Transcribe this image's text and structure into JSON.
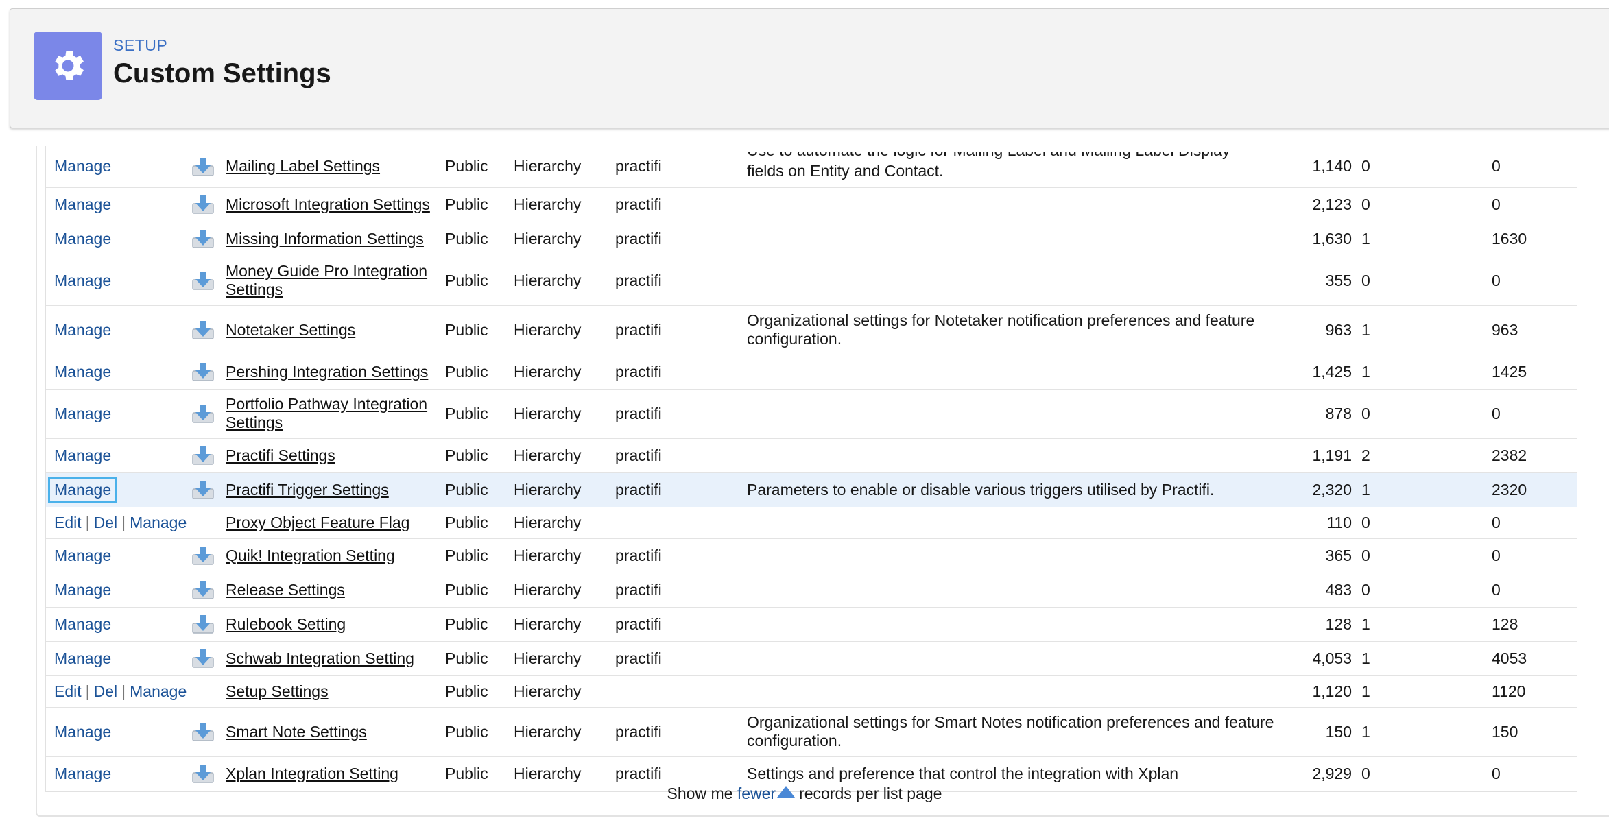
{
  "header": {
    "section": "SETUP",
    "title": "Custom Settings",
    "icon": "gear-icon",
    "icon_bg": "#7b87e8"
  },
  "rows": [
    {
      "actions": [
        "Manage"
      ],
      "packaged": true,
      "label": "Mailing Label Settings",
      "visibility": "Public",
      "type": "Hierarchy",
      "namespace": "practifi",
      "description": "fields on Entity and Contact.",
      "desc_cut": "Use to automate the logic for Mailing Label and Mailing Label Display",
      "size": "1,140",
      "records": "0",
      "total": "0"
    },
    {
      "actions": [
        "Manage"
      ],
      "packaged": true,
      "label": "Microsoft Integration Settings",
      "visibility": "Public",
      "type": "Hierarchy",
      "namespace": "practifi",
      "description": "",
      "size": "2,123",
      "records": "0",
      "total": "0"
    },
    {
      "actions": [
        "Manage"
      ],
      "packaged": true,
      "label": "Missing Information Settings",
      "visibility": "Public",
      "type": "Hierarchy",
      "namespace": "practifi",
      "description": "",
      "size": "1,630",
      "records": "1",
      "total": "1630"
    },
    {
      "actions": [
        "Manage"
      ],
      "packaged": true,
      "label": "Money Guide Pro Integration Settings",
      "visibility": "Public",
      "type": "Hierarchy",
      "namespace": "practifi",
      "description": "",
      "size": "355",
      "records": "0",
      "total": "0"
    },
    {
      "actions": [
        "Manage"
      ],
      "packaged": true,
      "label": "Notetaker Settings",
      "visibility": "Public",
      "type": "Hierarchy",
      "namespace": "practifi",
      "description": "Organizational settings for Notetaker notification preferences and feature configuration.",
      "size": "963",
      "records": "1",
      "total": "963"
    },
    {
      "actions": [
        "Manage"
      ],
      "packaged": true,
      "label": "Pershing Integration Settings",
      "visibility": "Public",
      "type": "Hierarchy",
      "namespace": "practifi",
      "description": "",
      "size": "1,425",
      "records": "1",
      "total": "1425"
    },
    {
      "actions": [
        "Manage"
      ],
      "packaged": true,
      "label": "Portfolio Pathway Integration Settings",
      "visibility": "Public",
      "type": "Hierarchy",
      "namespace": "practifi",
      "description": "",
      "size": "878",
      "records": "0",
      "total": "0"
    },
    {
      "actions": [
        "Manage"
      ],
      "packaged": true,
      "label": "Practifi Settings",
      "visibility": "Public",
      "type": "Hierarchy",
      "namespace": "practifi",
      "description": "",
      "size": "1,191",
      "records": "2",
      "total": "2382"
    },
    {
      "actions": [
        "Manage"
      ],
      "packaged": true,
      "highlight": true,
      "label": "Practifi Trigger Settings",
      "visibility": "Public",
      "type": "Hierarchy",
      "namespace": "practifi",
      "description": "Parameters to enable or disable various triggers utilised by Practifi.",
      "size": "2,320",
      "records": "1",
      "total": "2320"
    },
    {
      "actions": [
        "Edit",
        "Del",
        "Manage"
      ],
      "packaged": false,
      "label": "Proxy Object Feature Flag",
      "visibility": "Public",
      "type": "Hierarchy",
      "namespace": "",
      "description": "",
      "size": "110",
      "records": "0",
      "total": "0"
    },
    {
      "actions": [
        "Manage"
      ],
      "packaged": true,
      "label": "Quik! Integration Setting",
      "visibility": "Public",
      "type": "Hierarchy",
      "namespace": "practifi",
      "description": "",
      "size": "365",
      "records": "0",
      "total": "0"
    },
    {
      "actions": [
        "Manage"
      ],
      "packaged": true,
      "label": "Release Settings",
      "visibility": "Public",
      "type": "Hierarchy",
      "namespace": "practifi",
      "description": "",
      "size": "483",
      "records": "0",
      "total": "0"
    },
    {
      "actions": [
        "Manage"
      ],
      "packaged": true,
      "label": "Rulebook Setting",
      "visibility": "Public",
      "type": "Hierarchy",
      "namespace": "practifi",
      "description": "",
      "size": "128",
      "records": "1",
      "total": "128"
    },
    {
      "actions": [
        "Manage"
      ],
      "packaged": true,
      "label": "Schwab Integration Setting",
      "visibility": "Public",
      "type": "Hierarchy",
      "namespace": "practifi",
      "description": "",
      "size": "4,053",
      "records": "1",
      "total": "4053"
    },
    {
      "actions": [
        "Edit",
        "Del",
        "Manage"
      ],
      "packaged": false,
      "label": "Setup Settings",
      "visibility": "Public",
      "type": "Hierarchy",
      "namespace": "",
      "description": "",
      "size": "1,120",
      "records": "1",
      "total": "1120"
    },
    {
      "actions": [
        "Manage"
      ],
      "packaged": true,
      "label": "Smart Note Settings",
      "visibility": "Public",
      "type": "Hierarchy",
      "namespace": "practifi",
      "description": "Organizational settings for Smart Notes notification preferences and feature configuration.",
      "size": "150",
      "records": "1",
      "total": "150"
    },
    {
      "actions": [
        "Manage"
      ],
      "packaged": true,
      "label": "Xplan Integration Setting",
      "visibility": "Public",
      "type": "Hierarchy",
      "namespace": "practifi",
      "description": "Settings and preference that control the integration with Xplan",
      "size": "2,929",
      "records": "0",
      "total": "0"
    }
  ],
  "footer": {
    "prefix": "Show me",
    "link": "fewer",
    "suffix": "records per list page"
  }
}
